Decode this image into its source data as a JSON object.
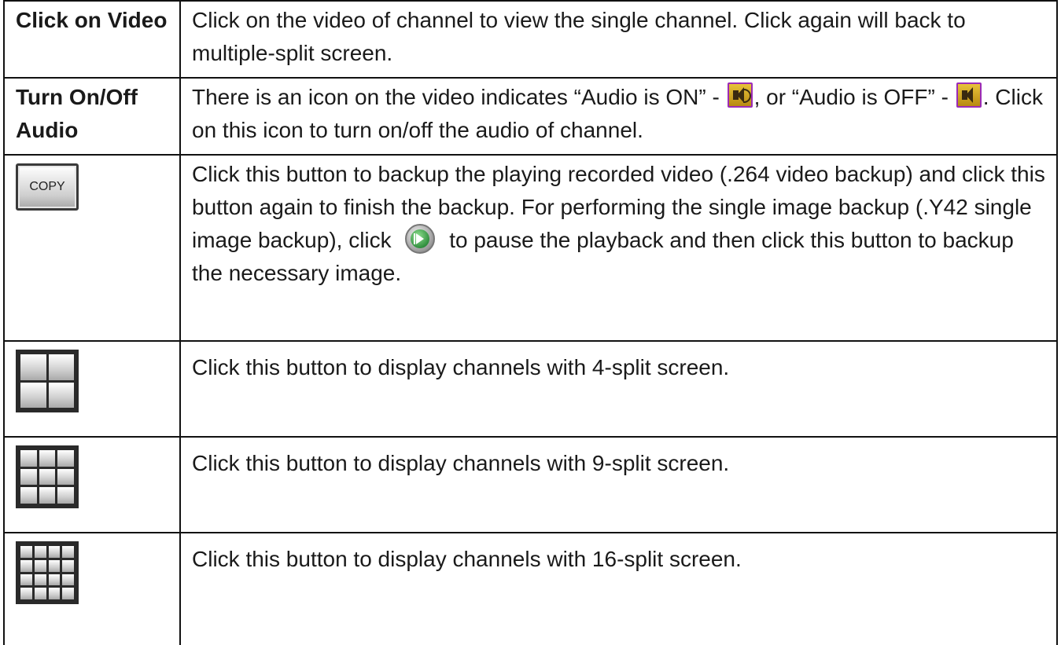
{
  "rows": [
    {
      "label": "Click on Video",
      "text": "Click on the video of channel to view the single channel. Click again will back to multiple-split screen."
    },
    {
      "label": "Turn On/Off Audio",
      "text_a": "There is an icon on the video indicates “Audio is ON” - ",
      "text_b": ", or “Audio is OFF” - ",
      "text_c": ". Click on this icon to turn on/off the audio of channel.",
      "icons": [
        "audio-on-icon",
        "audio-off-icon"
      ]
    },
    {
      "button_label": "COPY",
      "text_a": "Click this button to backup the playing recorded video (.264 video backup) and click this button again to finish the backup. For performing the single image backup (.Y42 single image backup), click ",
      "text_b": " to pause the playback and then click this button to backup the necessary image.",
      "icons": [
        "copy-button-icon",
        "play-pause-icon"
      ]
    },
    {
      "text": "Click this button to display channels with 4-split screen.",
      "icon": "split-4-icon"
    },
    {
      "text": "Click this button to display channels with 9-split screen.",
      "icon": "split-9-icon"
    },
    {
      "text": "Click this button to display channels with 16-split screen.",
      "icon": "split-16-icon"
    }
  ]
}
